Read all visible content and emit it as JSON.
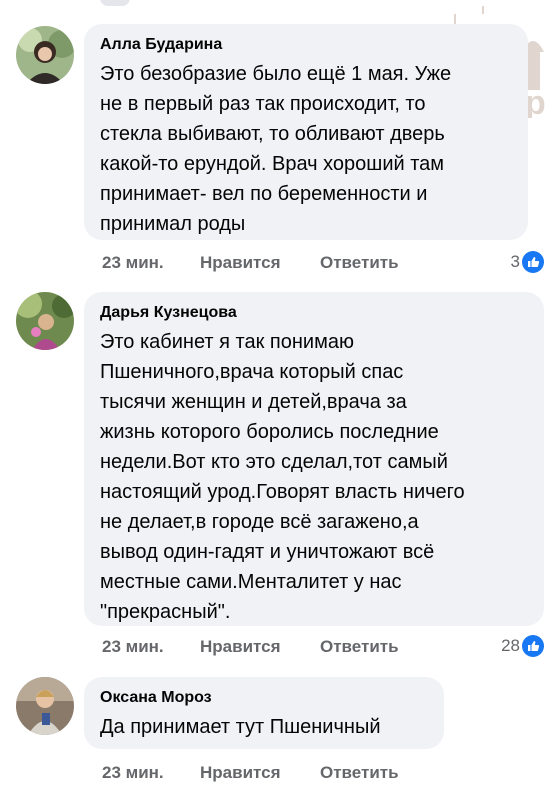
{
  "watermark_text": "ZaБор",
  "comments": [
    {
      "author": "Алла Бударина",
      "text": "Это безобразие было ещё 1 мая. Уже\nне в первый раз так происходит, то\nстекла выбивают, то обливают дверь\nкакой-то ерундой. Врач хороший там\nпринимает- вел по беременности и\nпринимал роды",
      "time": "23 мин.",
      "like_label": "Нравится",
      "reply_label": "Ответить",
      "reactions": "3"
    },
    {
      "author": "Дарья Кузнецова",
      "text": "Это кабинет я так понимаю\nПшеничного,врача который спас\nтысячи женщин и детей,врача за\nжизнь которого боролись последние\nнедели.Вот кто это сделал,тот самый\nнастоящий урод.Говорят власть ничего\nне делает,в городе всё загажено,а\nвывод один-гадят и уничтожают всё\nместные сами.Менталитет у нас\n\"прекрасный\".",
      "time": "23 мин.",
      "like_label": "Нравится",
      "reply_label": "Ответить",
      "reactions": "28"
    },
    {
      "author": "Оксана Мороз",
      "text": "Да принимает тут Пшеничный",
      "time": "23 мин.",
      "like_label": "Нравится",
      "reply_label": "Ответить",
      "reactions": ""
    }
  ],
  "colors": {
    "bubble": "#f0f2f5",
    "meta": "#65676b",
    "like_blue": "#1877f2"
  },
  "icons": [
    "like-icon",
    "avatar"
  ]
}
